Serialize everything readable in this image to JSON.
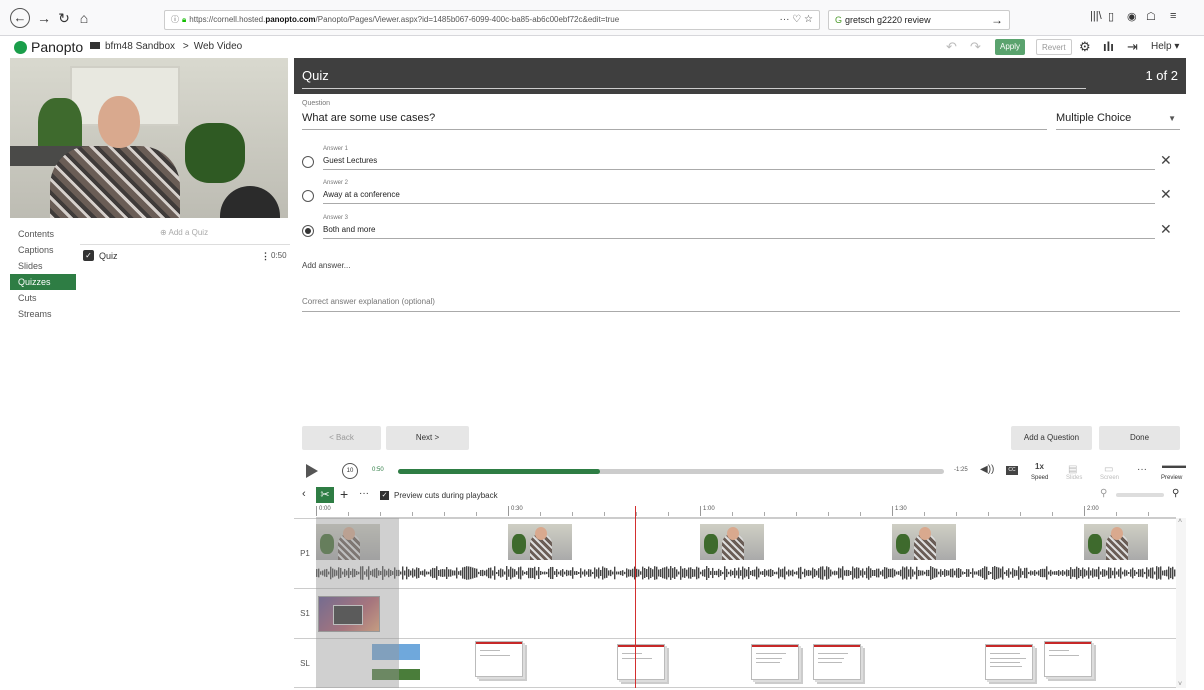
{
  "browser": {
    "url_prefix": "https://cornell.hosted.",
    "url_domain": "panopto.com",
    "url_rest": "/Panopto/Pages/Viewer.aspx?id=1485b067-6099-400c-ba85-ab6c00ebf72c&edit=true",
    "url_actions": "··· ♡ ☆",
    "search_text": "gretsch g2220 review"
  },
  "app": {
    "logo": "Panopto",
    "breadcrumb_folder": "bfm48 Sandbox",
    "breadcrumb_sep": ">",
    "breadcrumb_page": "Web Video",
    "apply": "Apply",
    "revert": "Revert",
    "help": "Help ▾"
  },
  "leftnav": {
    "items": [
      "Contents",
      "Captions",
      "Slides",
      "Quizzes",
      "Cuts",
      "Streams"
    ],
    "active": "Quizzes",
    "add_quiz": "⊕ Add a Quiz",
    "quiz_item_label": "Quiz",
    "quiz_item_time": "0:50"
  },
  "quiz": {
    "title": "Quiz",
    "page": "1 of 2",
    "question_label": "Question",
    "question_text": "What are some use cases?",
    "type": "Multiple Choice",
    "answers": [
      {
        "label": "Answer 1",
        "text": "Guest Lectures",
        "selected": false
      },
      {
        "label": "Answer 2",
        "text": "Away at a conference",
        "selected": false
      },
      {
        "label": "Answer 3",
        "text": "Both and more",
        "selected": true
      }
    ],
    "add_answer": "Add answer...",
    "explanation_placeholder": "Correct answer explanation (optional)",
    "back": "< Back",
    "next": "Next >",
    "add_question": "Add a Question",
    "done": "Done"
  },
  "player": {
    "current_time": "0:50",
    "remaining_time": "-1:25",
    "progress": 0.37,
    "cc": "CC",
    "speed_value": "1x",
    "speed_label": "Speed",
    "slides_label": "Slides",
    "screen_label": "Screen",
    "preview_label": "Preview"
  },
  "editor": {
    "preview_cuts_label": "Preview cuts during playback",
    "ruler_ticks": [
      "0:00",
      "0:30",
      "1:00",
      "1:30",
      "2:00"
    ],
    "tracks": [
      "P1",
      "S1",
      "SL"
    ]
  },
  "colors": {
    "accent": "#2e7d44",
    "playhead": "#d32f2f",
    "quiz_header": "#3f3f3f"
  }
}
